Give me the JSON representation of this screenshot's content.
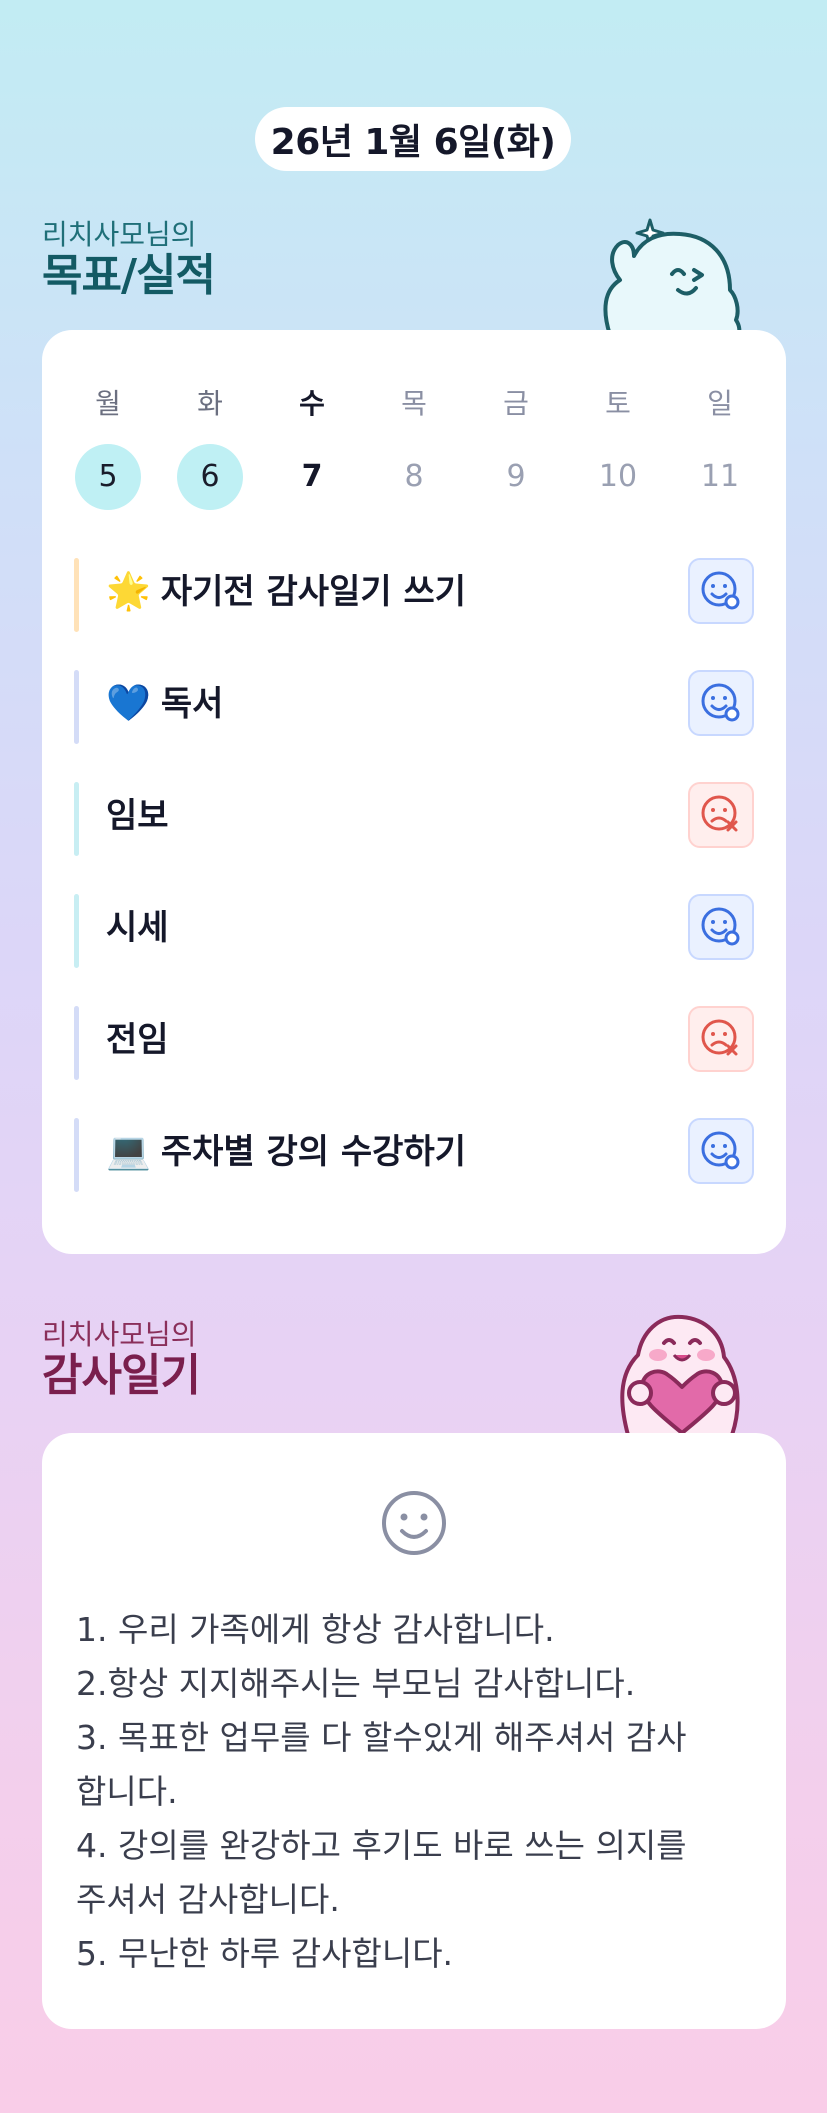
{
  "header": {
    "date": "26년 1월 6일(화)"
  },
  "goals_section": {
    "subtitle": "리치사모님의",
    "title": "목표/실적"
  },
  "week": [
    {
      "label": "월",
      "num": "5",
      "state": "done"
    },
    {
      "label": "화",
      "num": "6",
      "state": "done"
    },
    {
      "label": "수",
      "num": "7",
      "state": "today"
    },
    {
      "label": "목",
      "num": "8",
      "state": "future"
    },
    {
      "label": "금",
      "num": "9",
      "state": "future"
    },
    {
      "label": "토",
      "num": "10",
      "state": "future"
    },
    {
      "label": "일",
      "num": "11",
      "state": "future"
    }
  ],
  "goals": [
    {
      "emoji": "🌟",
      "text": "자기전 감사일기 쓰기",
      "status": "ok",
      "bar_color": "#ffe2b8"
    },
    {
      "emoji": "💙",
      "text": "독서",
      "status": "ok",
      "bar_color": "#d4dcf7"
    },
    {
      "emoji": "",
      "text": "임보",
      "status": "fail",
      "bar_color": "#c8eef3"
    },
    {
      "emoji": "",
      "text": "시세",
      "status": "ok",
      "bar_color": "#c8eef3"
    },
    {
      "emoji": "",
      "text": "전임",
      "status": "fail",
      "bar_color": "#d4dcf7"
    },
    {
      "emoji": "💻",
      "text": "주차별 강의 수강하기",
      "status": "ok",
      "bar_color": "#d4dcf7"
    }
  ],
  "diary_section": {
    "subtitle": "리치사모님의",
    "title": "감사일기"
  },
  "diary": {
    "icon": "smile-icon",
    "lines": [
      "1. 우리 가족에게 항상 감사합니다.",
      "2.항상 지지해주시는 부모님 감사합니다.",
      "3. 목표한 업무를 다 할수있게 해주셔서 감사",
      "합니다.",
      "4. 강의를 완강하고 후기도 바로 쓰는 의지를",
      "주셔서 감사합니다.",
      "5. 무난한 하루 감사합니다."
    ]
  },
  "colors": {
    "ok": "#3b6fe0",
    "fail": "#e0564c",
    "accent": "#bff0f4"
  }
}
